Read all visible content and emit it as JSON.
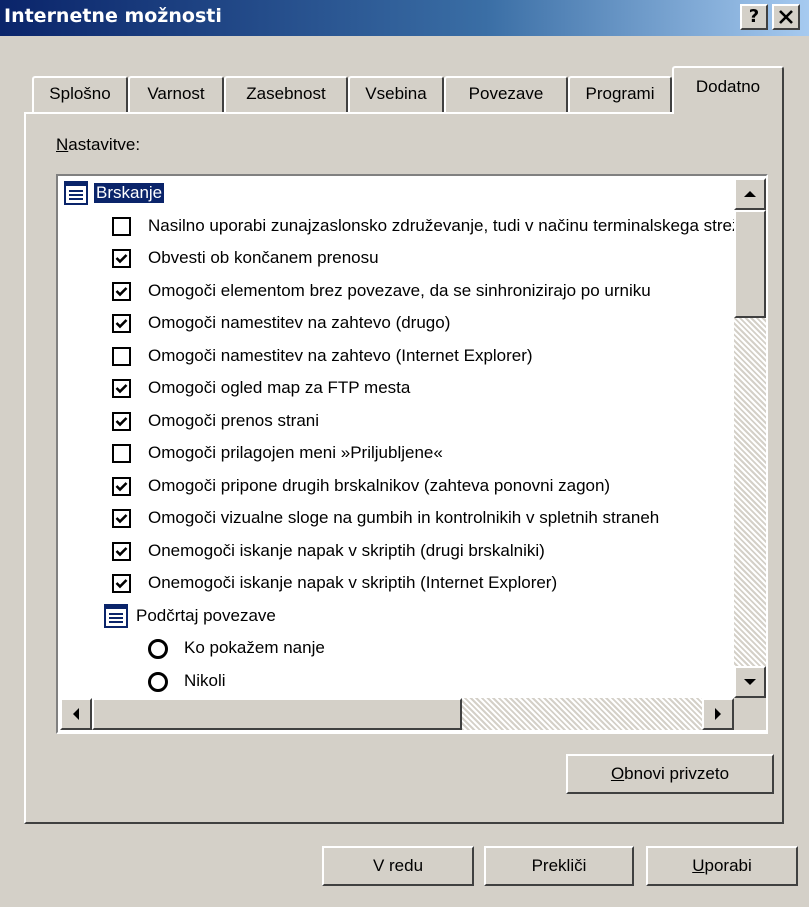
{
  "window": {
    "title": "Internetne možnosti",
    "help_label": "?",
    "close_label": "✕"
  },
  "tabs": [
    {
      "label": "Splošno",
      "active": false
    },
    {
      "label": "Varnost",
      "active": false
    },
    {
      "label": "Zasebnost",
      "active": false
    },
    {
      "label": "Vsebina",
      "active": false
    },
    {
      "label": "Povezave",
      "active": false
    },
    {
      "label": "Programi",
      "active": false
    },
    {
      "label": "Dodatno",
      "active": true
    }
  ],
  "settings_label": {
    "mnemonic": "N",
    "rest": "astavitve:"
  },
  "settings_list": {
    "items": [
      {
        "type": "group",
        "label": "Brskanje",
        "selected": true
      },
      {
        "type": "checkbox",
        "label": "Nasilno uporabi zunajzaslonsko združevanje, tudi v načinu terminalskega strežnika",
        "checked": false
      },
      {
        "type": "checkbox",
        "label": "Obvesti ob končanem prenosu",
        "checked": true
      },
      {
        "type": "checkbox",
        "label": "Omogoči elementom brez povezave, da se sinhronizirajo po urniku",
        "checked": true
      },
      {
        "type": "checkbox",
        "label": "Omogoči namestitev na zahtevo (drugo)",
        "checked": true
      },
      {
        "type": "checkbox",
        "label": "Omogoči namestitev na zahtevo (Internet Explorer)",
        "checked": false
      },
      {
        "type": "checkbox",
        "label": "Omogoči ogled map za FTP mesta",
        "checked": true
      },
      {
        "type": "checkbox",
        "label": "Omogoči prenos strani",
        "checked": true
      },
      {
        "type": "checkbox",
        "label": "Omogoči prilagojen meni »Priljubljene«",
        "checked": false
      },
      {
        "type": "checkbox",
        "label": "Omogoči pripone drugih brskalnikov (zahteva ponovni zagon)",
        "checked": true
      },
      {
        "type": "checkbox",
        "label": "Omogoči vizualne sloge na gumbih in kontrolnikih v spletnih straneh",
        "checked": true
      },
      {
        "type": "checkbox",
        "label": "Onemogoči iskanje napak v skriptih (drugi brskalniki)",
        "checked": true
      },
      {
        "type": "checkbox",
        "label": "Onemogoči iskanje napak v skriptih (Internet Explorer)",
        "checked": true
      },
      {
        "type": "group",
        "label": "Podčrtaj povezave",
        "selected": false,
        "indent": 1
      },
      {
        "type": "radio",
        "label": "Ko pokažem nanje",
        "checked": false
      },
      {
        "type": "radio",
        "label": "Nikoli",
        "checked": false
      }
    ]
  },
  "buttons": {
    "restore": {
      "mnemonic": "O",
      "rest": "bnovi privzeto"
    },
    "ok": "V redu",
    "cancel": "Prekliči",
    "apply": {
      "mnemonic": "U",
      "rest": "porabi"
    }
  },
  "icons": {
    "check": "check-mark-icon",
    "group": "list-group-icon",
    "scroll_up": "arrow-up-icon",
    "scroll_down": "arrow-down-icon",
    "scroll_left": "arrow-left-icon",
    "scroll_right": "arrow-right-icon"
  },
  "colors": {
    "title_gradient_start": "#0a246a",
    "title_gradient_end": "#a6caf0",
    "face": "#d4d0c8",
    "selection": "#0a246a"
  }
}
